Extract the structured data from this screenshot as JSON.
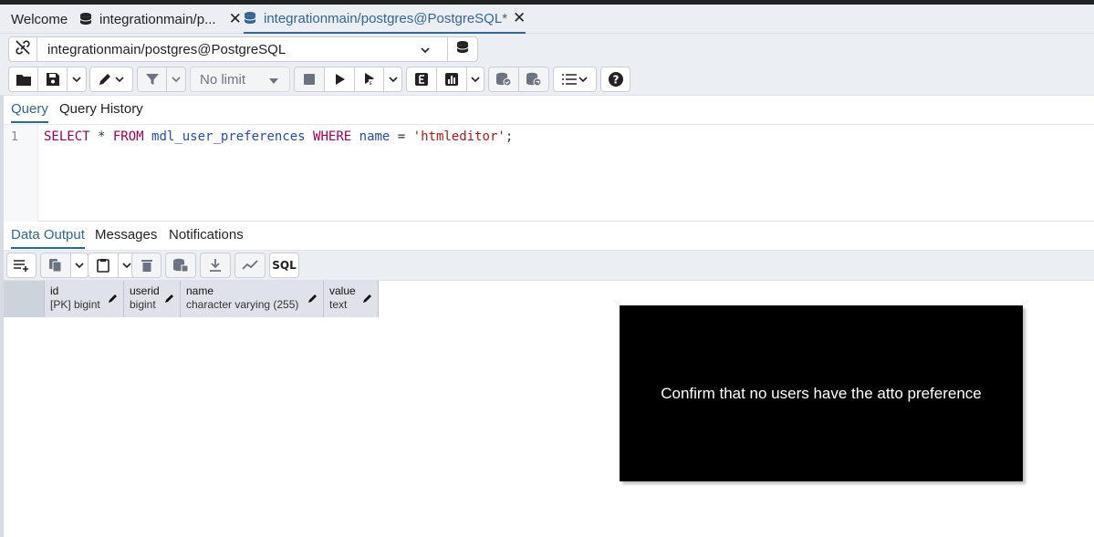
{
  "tabs": [
    {
      "label": "Welcome",
      "active": false
    },
    {
      "label": "integrationmain/p...",
      "active": false
    },
    {
      "label": "integrationmain/postgres@PostgreSQL*",
      "active": true
    }
  ],
  "tab_close_glyph": "✕",
  "connection": {
    "label": "integrationmain/postgres@PostgreSQL"
  },
  "toolbar": {
    "limit_label": "No limit"
  },
  "query_tabs": [
    {
      "label": "Query",
      "active": true
    },
    {
      "label": "Query History",
      "active": false
    }
  ],
  "editor": {
    "line_number": "1",
    "tokens": {
      "select": "SELECT",
      "star": " * ",
      "from": "FROM",
      "table": "mdl_user_preferences",
      "where": "WHERE",
      "col": "name",
      "eq": " = ",
      "value": "'htmleditor'",
      "semi": ";"
    }
  },
  "output_tabs": [
    {
      "label": "Data Output",
      "active": true
    },
    {
      "label": "Messages",
      "active": false
    },
    {
      "label": "Notifications",
      "active": false
    }
  ],
  "output_toolbar": {
    "sql_label": "SQL"
  },
  "columns": [
    {
      "name": "id",
      "type": "[PK] bigint"
    },
    {
      "name": "userid",
      "type": "bigint"
    },
    {
      "name": "name",
      "type": "character varying (255)"
    },
    {
      "name": "value",
      "type": "text"
    }
  ],
  "overlay": {
    "text": "Confirm that no users have the atto preference"
  },
  "colors": {
    "accent": "#326690",
    "keyword": "#990055",
    "identifier": "#2a4d9c",
    "string": "#a11d1d"
  }
}
